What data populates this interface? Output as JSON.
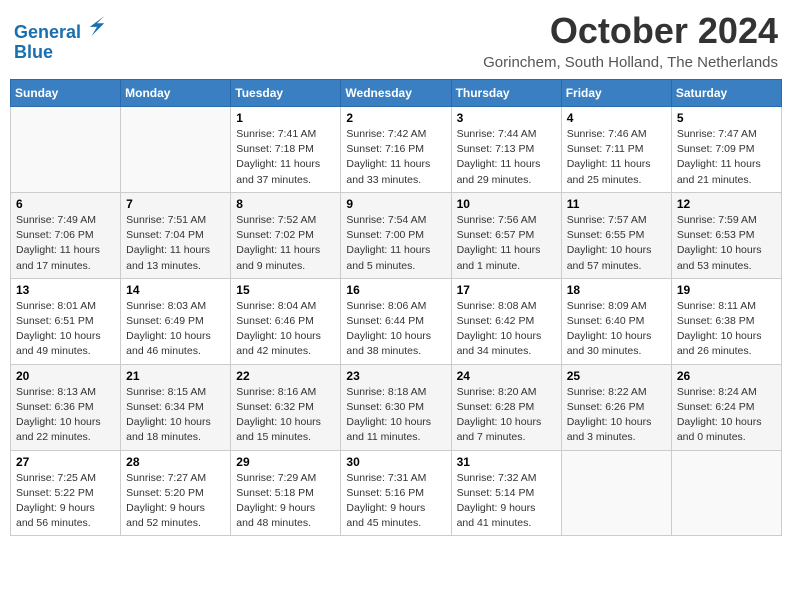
{
  "header": {
    "logo_line1": "General",
    "logo_line2": "Blue",
    "month": "October 2024",
    "location": "Gorinchem, South Holland, The Netherlands"
  },
  "days_of_week": [
    "Sunday",
    "Monday",
    "Tuesday",
    "Wednesday",
    "Thursday",
    "Friday",
    "Saturday"
  ],
  "weeks": [
    [
      {
        "day": "",
        "info": ""
      },
      {
        "day": "",
        "info": ""
      },
      {
        "day": "1",
        "info": "Sunrise: 7:41 AM\nSunset: 7:18 PM\nDaylight: 11 hours and 37 minutes."
      },
      {
        "day": "2",
        "info": "Sunrise: 7:42 AM\nSunset: 7:16 PM\nDaylight: 11 hours and 33 minutes."
      },
      {
        "day": "3",
        "info": "Sunrise: 7:44 AM\nSunset: 7:13 PM\nDaylight: 11 hours and 29 minutes."
      },
      {
        "day": "4",
        "info": "Sunrise: 7:46 AM\nSunset: 7:11 PM\nDaylight: 11 hours and 25 minutes."
      },
      {
        "day": "5",
        "info": "Sunrise: 7:47 AM\nSunset: 7:09 PM\nDaylight: 11 hours and 21 minutes."
      }
    ],
    [
      {
        "day": "6",
        "info": "Sunrise: 7:49 AM\nSunset: 7:06 PM\nDaylight: 11 hours and 17 minutes."
      },
      {
        "day": "7",
        "info": "Sunrise: 7:51 AM\nSunset: 7:04 PM\nDaylight: 11 hours and 13 minutes."
      },
      {
        "day": "8",
        "info": "Sunrise: 7:52 AM\nSunset: 7:02 PM\nDaylight: 11 hours and 9 minutes."
      },
      {
        "day": "9",
        "info": "Sunrise: 7:54 AM\nSunset: 7:00 PM\nDaylight: 11 hours and 5 minutes."
      },
      {
        "day": "10",
        "info": "Sunrise: 7:56 AM\nSunset: 6:57 PM\nDaylight: 11 hours and 1 minute."
      },
      {
        "day": "11",
        "info": "Sunrise: 7:57 AM\nSunset: 6:55 PM\nDaylight: 10 hours and 57 minutes."
      },
      {
        "day": "12",
        "info": "Sunrise: 7:59 AM\nSunset: 6:53 PM\nDaylight: 10 hours and 53 minutes."
      }
    ],
    [
      {
        "day": "13",
        "info": "Sunrise: 8:01 AM\nSunset: 6:51 PM\nDaylight: 10 hours and 49 minutes."
      },
      {
        "day": "14",
        "info": "Sunrise: 8:03 AM\nSunset: 6:49 PM\nDaylight: 10 hours and 46 minutes."
      },
      {
        "day": "15",
        "info": "Sunrise: 8:04 AM\nSunset: 6:46 PM\nDaylight: 10 hours and 42 minutes."
      },
      {
        "day": "16",
        "info": "Sunrise: 8:06 AM\nSunset: 6:44 PM\nDaylight: 10 hours and 38 minutes."
      },
      {
        "day": "17",
        "info": "Sunrise: 8:08 AM\nSunset: 6:42 PM\nDaylight: 10 hours and 34 minutes."
      },
      {
        "day": "18",
        "info": "Sunrise: 8:09 AM\nSunset: 6:40 PM\nDaylight: 10 hours and 30 minutes."
      },
      {
        "day": "19",
        "info": "Sunrise: 8:11 AM\nSunset: 6:38 PM\nDaylight: 10 hours and 26 minutes."
      }
    ],
    [
      {
        "day": "20",
        "info": "Sunrise: 8:13 AM\nSunset: 6:36 PM\nDaylight: 10 hours and 22 minutes."
      },
      {
        "day": "21",
        "info": "Sunrise: 8:15 AM\nSunset: 6:34 PM\nDaylight: 10 hours and 18 minutes."
      },
      {
        "day": "22",
        "info": "Sunrise: 8:16 AM\nSunset: 6:32 PM\nDaylight: 10 hours and 15 minutes."
      },
      {
        "day": "23",
        "info": "Sunrise: 8:18 AM\nSunset: 6:30 PM\nDaylight: 10 hours and 11 minutes."
      },
      {
        "day": "24",
        "info": "Sunrise: 8:20 AM\nSunset: 6:28 PM\nDaylight: 10 hours and 7 minutes."
      },
      {
        "day": "25",
        "info": "Sunrise: 8:22 AM\nSunset: 6:26 PM\nDaylight: 10 hours and 3 minutes."
      },
      {
        "day": "26",
        "info": "Sunrise: 8:24 AM\nSunset: 6:24 PM\nDaylight: 10 hours and 0 minutes."
      }
    ],
    [
      {
        "day": "27",
        "info": "Sunrise: 7:25 AM\nSunset: 5:22 PM\nDaylight: 9 hours and 56 minutes."
      },
      {
        "day": "28",
        "info": "Sunrise: 7:27 AM\nSunset: 5:20 PM\nDaylight: 9 hours and 52 minutes."
      },
      {
        "day": "29",
        "info": "Sunrise: 7:29 AM\nSunset: 5:18 PM\nDaylight: 9 hours and 48 minutes."
      },
      {
        "day": "30",
        "info": "Sunrise: 7:31 AM\nSunset: 5:16 PM\nDaylight: 9 hours and 45 minutes."
      },
      {
        "day": "31",
        "info": "Sunrise: 7:32 AM\nSunset: 5:14 PM\nDaylight: 9 hours and 41 minutes."
      },
      {
        "day": "",
        "info": ""
      },
      {
        "day": "",
        "info": ""
      }
    ]
  ]
}
